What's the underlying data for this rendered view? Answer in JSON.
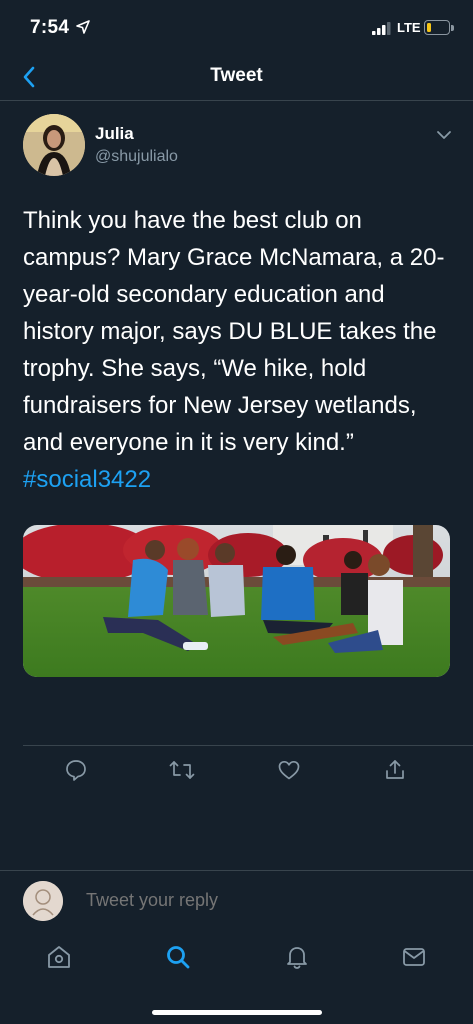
{
  "status": {
    "time": "7:54",
    "network": "LTE"
  },
  "nav": {
    "title": "Tweet",
    "back_icon": "chevron-left-icon"
  },
  "tweet": {
    "author_name": "Julia",
    "author_handle": "@shujulialo",
    "text": "Think you have the best club on campus? Mary Grace McNamara, a 20-year-old secondary education and history major, says DU BLUE takes the trophy. She says, “We hike, hold fundraisers for New Jersey wetlands, and everyone in it is very kind.”",
    "hashtag": "#social3422"
  },
  "actions": [
    "reply-icon",
    "retweet-icon",
    "like-icon",
    "share-icon"
  ],
  "reply": {
    "placeholder": "Tweet your reply"
  },
  "tabs": [
    "home-icon",
    "search-icon",
    "notifications-icon",
    "messages-icon"
  ],
  "colors": {
    "background": "#15202b",
    "accent": "#1da1f2",
    "secondary_text": "#8899a6",
    "divider": "#38444d"
  }
}
